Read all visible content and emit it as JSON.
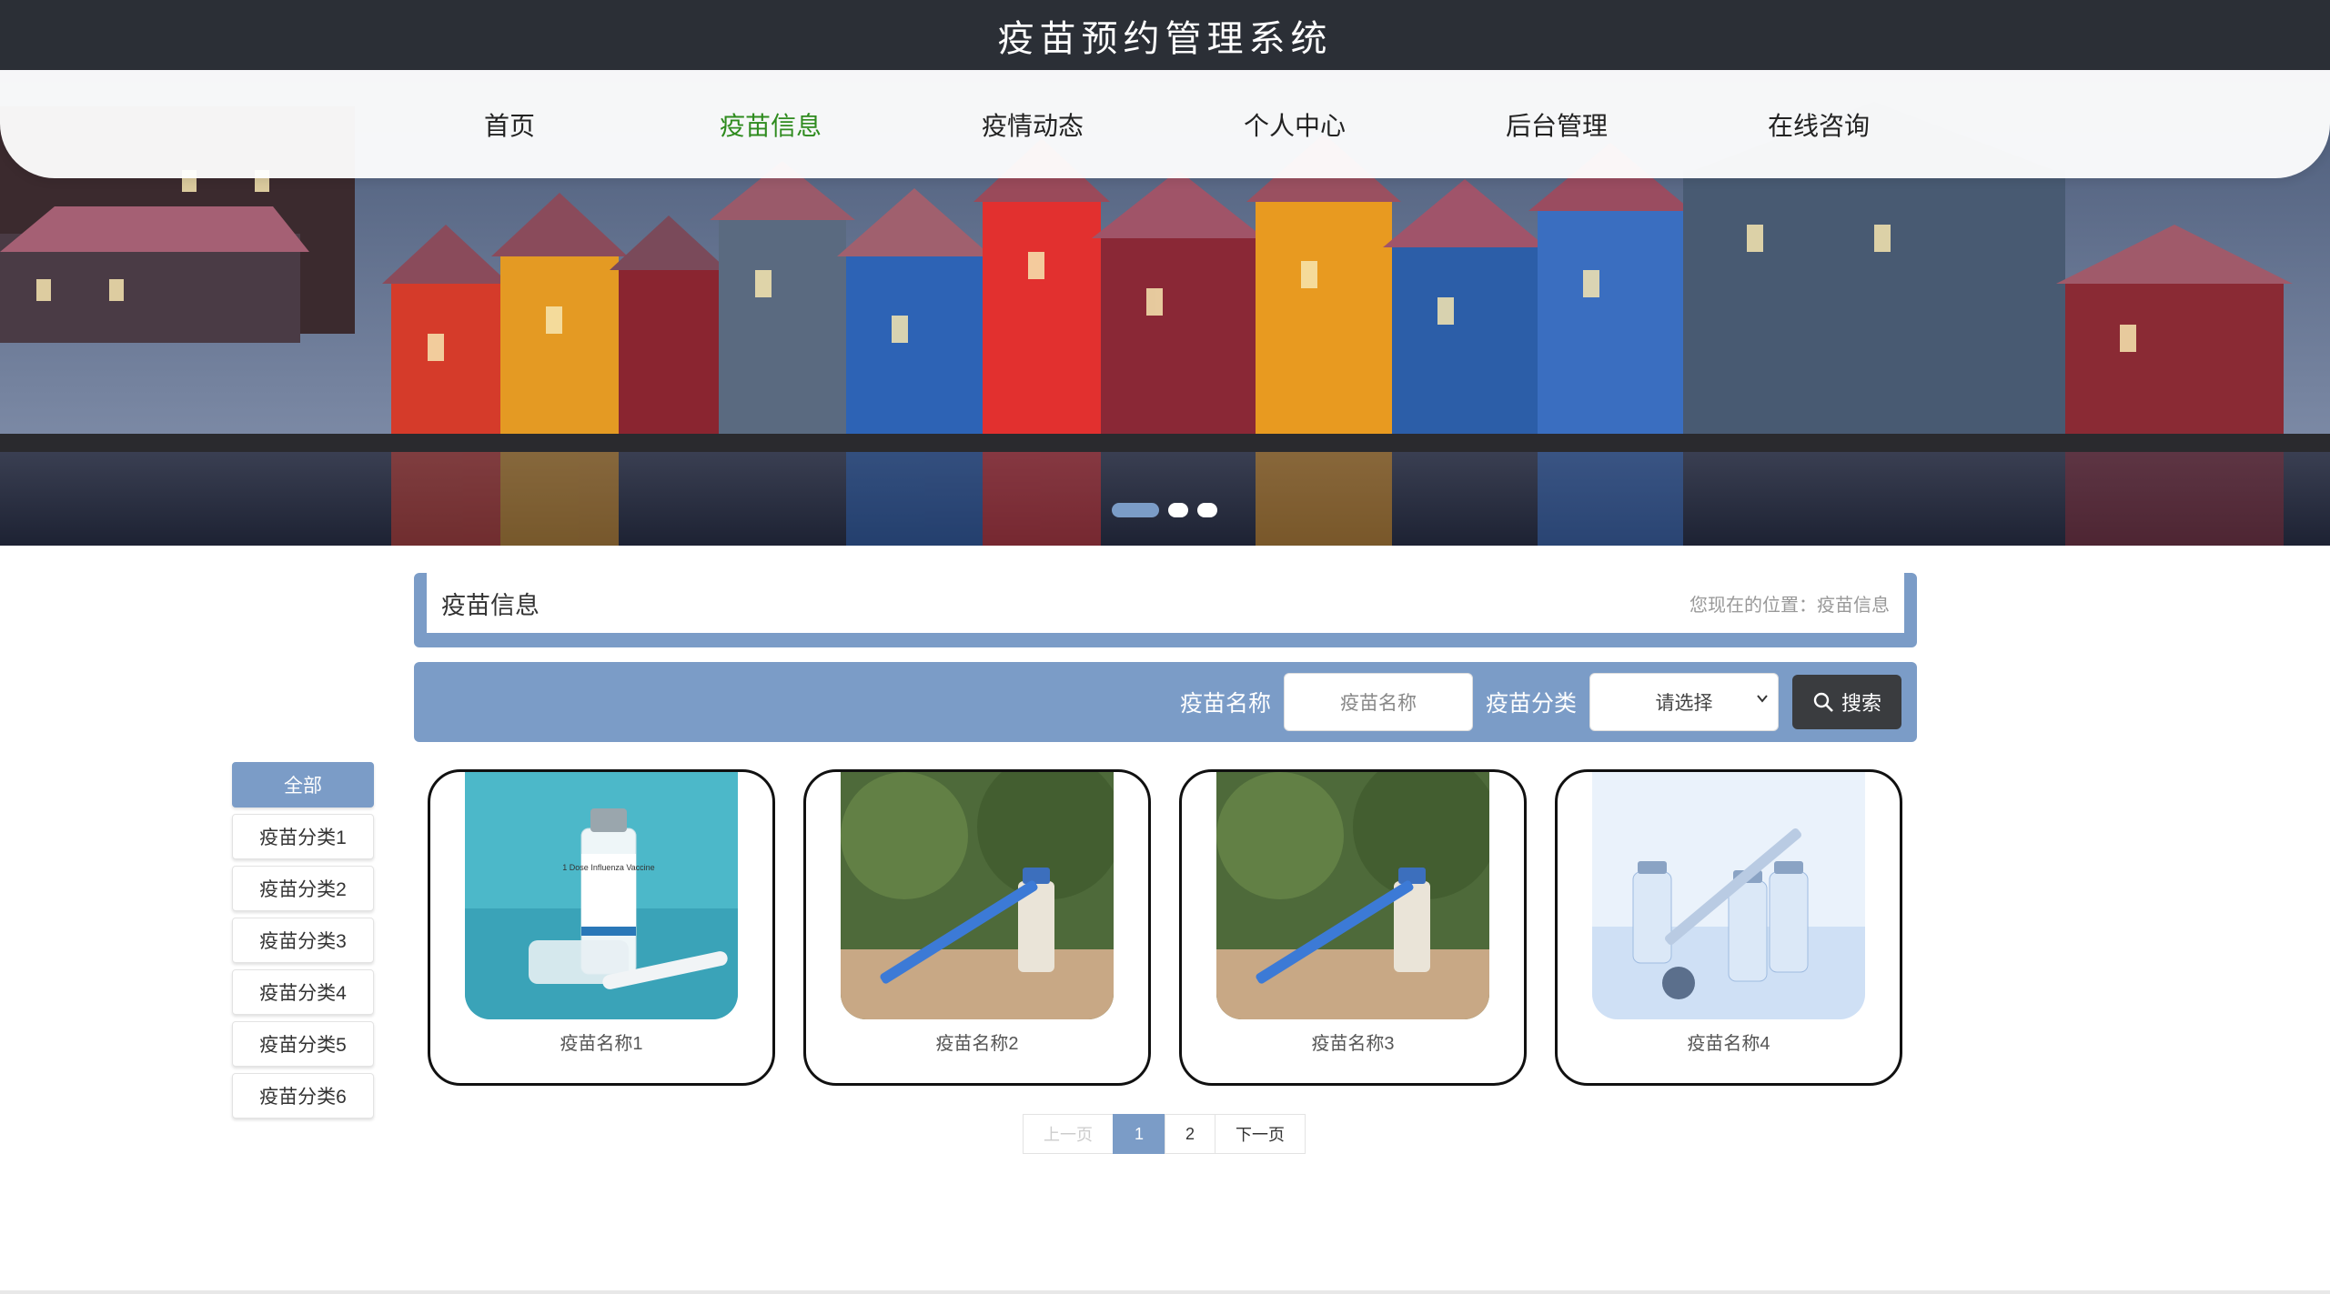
{
  "header": {
    "title": "疫苗预约管理系统"
  },
  "nav": {
    "items": [
      {
        "label": "首页"
      },
      {
        "label": "疫苗信息",
        "active": true
      },
      {
        "label": "疫情动态"
      },
      {
        "label": "个人中心"
      },
      {
        "label": "后台管理"
      },
      {
        "label": "在线咨询"
      }
    ]
  },
  "carousel": {
    "slide_count": 3,
    "active_index": 0
  },
  "section": {
    "title": "疫苗信息",
    "breadcrumb": "您现在的位置：疫苗信息"
  },
  "search": {
    "name_label": "疫苗名称",
    "name_placeholder": "疫苗名称",
    "category_label": "疫苗分类",
    "category_selected": "请选择",
    "button_label": "搜索",
    "button_icon": "search-icon"
  },
  "categories": {
    "items": [
      {
        "label": "全部",
        "active": true
      },
      {
        "label": "疫苗分类1"
      },
      {
        "label": "疫苗分类2"
      },
      {
        "label": "疫苗分类3"
      },
      {
        "label": "疫苗分类4"
      },
      {
        "label": "疫苗分类5"
      },
      {
        "label": "疫苗分类6"
      }
    ]
  },
  "products": {
    "items": [
      {
        "name": "疫苗名称1",
        "image": "vaccine-vial-image",
        "vial_label": "1 Dose Influenza Vaccine"
      },
      {
        "name": "疫苗名称2",
        "image": "syringe-vial-image"
      },
      {
        "name": "疫苗名称3",
        "image": "syringe-vial-image"
      },
      {
        "name": "疫苗名称4",
        "image": "vials-syringe-image"
      }
    ]
  },
  "pagination": {
    "prev": "上一页",
    "pages": [
      "1",
      "2"
    ],
    "current": "1",
    "next": "下一页"
  },
  "colors": {
    "accent": "#7b9cc7",
    "nav_active": "#2e8b1e",
    "titlebar": "#2b2f36",
    "button_dark": "#3a3c3f"
  }
}
